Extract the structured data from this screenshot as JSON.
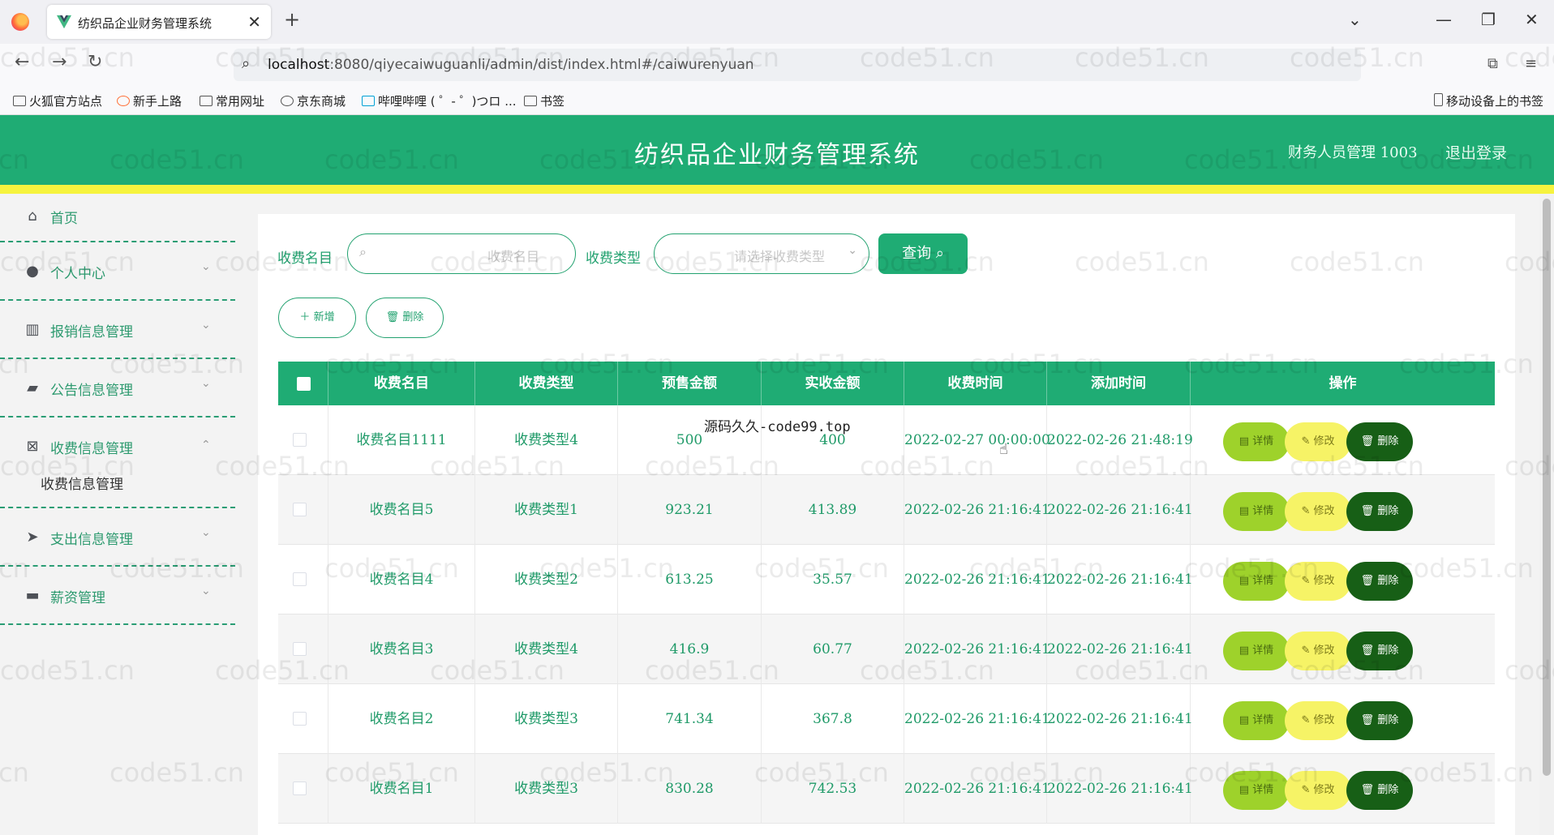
{
  "browser": {
    "tab_title": "纺织品企业财务管理系统",
    "url_host": "localhost",
    "url_rest": ":8080/qiyecaiwuguanli/admin/dist/index.html#/caiwurenyuan",
    "bookmarks": [
      "火狐官方站点",
      "新手上路",
      "常用网址",
      "京东商城",
      "哔哩哔哩 ( ゜- ゜)つロ ...",
      "书签"
    ],
    "mobile_bookmarks": "移动设备上的书签"
  },
  "header": {
    "title": "纺织品企业财务管理系统",
    "user": "财务人员管理 1003",
    "logout": "退出登录"
  },
  "sidebar": {
    "items": [
      {
        "label": "首页",
        "icon": "home-icon"
      },
      {
        "label": "个人中心",
        "icon": "user-icon"
      },
      {
        "label": "报销信息管理",
        "icon": "report-icon"
      },
      {
        "label": "公告信息管理",
        "icon": "wallet-icon"
      },
      {
        "label": "收费信息管理",
        "icon": "clipboard-icon"
      },
      {
        "label": "支出信息管理",
        "icon": "send-icon"
      },
      {
        "label": "薪资管理",
        "icon": "ticket-icon"
      }
    ],
    "submenu_label": "收费信息管理"
  },
  "search": {
    "name_label": "收费名目",
    "name_placeholder": "收费名目",
    "type_label": "收费类型",
    "type_placeholder": "请选择收费类型",
    "query_button": "查询"
  },
  "actions": {
    "add": "新增",
    "delete": "删除"
  },
  "table": {
    "columns": [
      "收费名目",
      "收费类型",
      "预售金额",
      "实收金额",
      "收费时间",
      "添加时间",
      "操作"
    ],
    "rows": [
      {
        "name": "收费名目1111",
        "type": "收费类型4",
        "presale": "500",
        "actual": "400",
        "charge_time": "2022-02-27 00:00:00",
        "add_time": "2022-02-26 21:48:19"
      },
      {
        "name": "收费名目5",
        "type": "收费类型1",
        "presale": "923.21",
        "actual": "413.89",
        "charge_time": "2022-02-26 21:16:41",
        "add_time": "2022-02-26 21:16:41"
      },
      {
        "name": "收费名目4",
        "type": "收费类型2",
        "presale": "613.25",
        "actual": "35.57",
        "charge_time": "2022-02-26 21:16:41",
        "add_time": "2022-02-26 21:16:41"
      },
      {
        "name": "收费名目3",
        "type": "收费类型4",
        "presale": "416.9",
        "actual": "60.77",
        "charge_time": "2022-02-26 21:16:41",
        "add_time": "2022-02-26 21:16:41"
      },
      {
        "name": "收费名目2",
        "type": "收费类型3",
        "presale": "741.34",
        "actual": "367.8",
        "charge_time": "2022-02-26 21:16:41",
        "add_time": "2022-02-26 21:16:41"
      },
      {
        "name": "收费名目1",
        "type": "收费类型3",
        "presale": "830.28",
        "actual": "742.53",
        "charge_time": "2022-02-26 21:16:41",
        "add_time": "2022-02-26 21:16:41"
      }
    ],
    "op_labels": {
      "detail": "详情",
      "edit": "修改",
      "delete": "删除"
    }
  },
  "overlay_text": "源码久久-code99.top",
  "watermark": "code51.cn"
}
